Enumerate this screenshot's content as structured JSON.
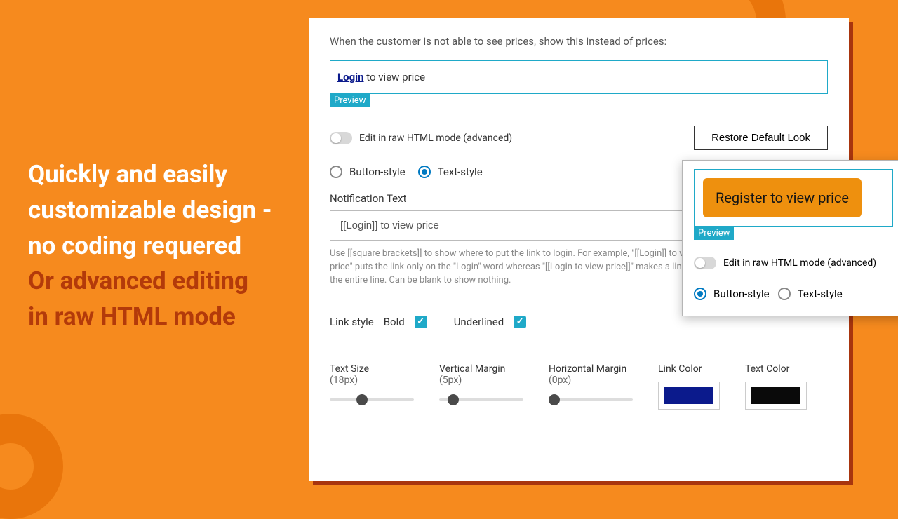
{
  "marketing": {
    "line1a": "Quickly and easily",
    "line1b": "customizable design -",
    "line1c": "no coding requered",
    "line2a": "Or advanced editing",
    "line2b": "in raw HTML mode"
  },
  "panel": {
    "intro": "When the customer is not able to see prices, show this instead of prices:",
    "preview_link_text": "Login",
    "preview_rest": " to view price",
    "preview_tag": "Preview",
    "raw_toggle_label": "Edit in raw HTML mode (advanced)",
    "restore_button": "Restore Default Look",
    "style_radio": {
      "button": "Button-style",
      "text": "Text-style",
      "selected": "text"
    },
    "notification_label": "Notification Text",
    "notification_value": "[[Login]] to view price",
    "help": "Use [[square brackets]] to show where to put the link to login.\nFor example, \"[[Login]] to view price\" puts the link only on the \"Login\" word whereas \"[[Login to view price]]\" makes a link on the entire line. Can be blank to show nothing.",
    "link_style_label": "Link style",
    "bold_label": "Bold",
    "underlined_label": "Underlined",
    "sliders": {
      "text_size": {
        "label": "Text Size",
        "value": "(18px)"
      },
      "v_margin": {
        "label": "Vertical Margin",
        "value": "(5px)"
      },
      "h_margin": {
        "label": "Horizontal Margin",
        "value": "(0px)"
      }
    },
    "link_color_label": "Link Color",
    "text_color_label": "Text Color",
    "colors": {
      "link": "#0b1a8c",
      "text": "#0a0a0a"
    }
  },
  "overlay": {
    "button_text": "Register to view price",
    "preview_tag": "Preview",
    "raw_toggle_label": "Edit in raw HTML mode (advanced)",
    "style_radio": {
      "button": "Button-style",
      "text": "Text-style",
      "selected": "button"
    }
  }
}
